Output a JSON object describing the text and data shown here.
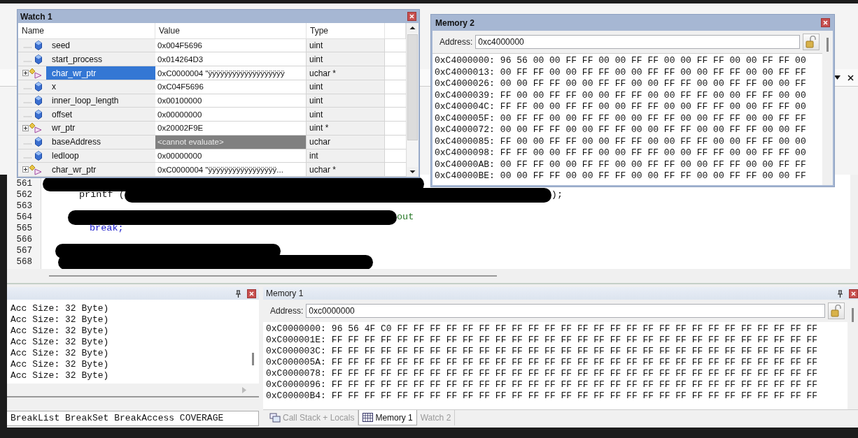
{
  "watch_window": {
    "title": "Watch 1",
    "columns": [
      "Name",
      "Value",
      "Type"
    ],
    "rows": [
      {
        "kind": "variable",
        "name": "seed",
        "value": "0x004F5696",
        "type": "uint",
        "selected": false,
        "unavailable": false
      },
      {
        "kind": "variable",
        "name": "start_process",
        "value": "0x014264D3",
        "type": "uint",
        "selected": false,
        "unavailable": false
      },
      {
        "kind": "pointer",
        "name": "char_wr_ptr",
        "value": "0xC0000004 \"ÿÿÿÿÿÿÿÿÿÿÿÿÿÿÿÿÿÿÿ",
        "type": "uchar *",
        "selected": true,
        "unavailable": false
      },
      {
        "kind": "variable",
        "name": "x",
        "value": "0xC04F5696",
        "type": "uint",
        "selected": false,
        "unavailable": false
      },
      {
        "kind": "variable",
        "name": "inner_loop_length",
        "value": "0x00100000",
        "type": "uint",
        "selected": false,
        "unavailable": false
      },
      {
        "kind": "variable",
        "name": "offset",
        "value": "0x00000000",
        "type": "uint",
        "selected": false,
        "unavailable": false
      },
      {
        "kind": "pointer",
        "name": "wr_ptr",
        "value": "0x20002F9E",
        "type": "uint *",
        "selected": false,
        "unavailable": false
      },
      {
        "kind": "variable",
        "name": "baseAddress",
        "value": "<cannot evaluate>",
        "type": "uchar",
        "selected": false,
        "unavailable": true
      },
      {
        "kind": "variable",
        "name": "ledloop",
        "value": "0x00000000",
        "type": "int",
        "selected": false,
        "unavailable": false
      },
      {
        "kind": "pointer",
        "name": "char_wr_ptr",
        "value": "0xC0000004 \"ÿÿÿÿÿÿÿÿÿÿÿÿÿÿÿÿÿ...",
        "type": "uchar *",
        "selected": false,
        "unavailable": false
      }
    ]
  },
  "memory_2": {
    "title": "Memory 2",
    "address_label": "Address:",
    "address": "0xc4000000",
    "rows": [
      {
        "address": "0xC4000000:",
        "bytes": "96 56 00 00 FF FF 00 00 FF FF 00 00 FF FF 00 00 FF FF 00"
      },
      {
        "address": "0xC4000013:",
        "bytes": "00 FF FF 00 00 FF FF 00 00 FF FF 00 00 FF FF 00 00 FF FF"
      },
      {
        "address": "0xC4000026:",
        "bytes": "00 00 FF FF 00 00 FF FF 00 00 FF FF 00 00 FF FF 00 00 FF"
      },
      {
        "address": "0xC4000039:",
        "bytes": "FF 00 00 FF FF 00 00 FF FF 00 00 FF FF 00 00 FF FF 00 00"
      },
      {
        "address": "0xC400004C:",
        "bytes": "FF FF 00 00 FF FF 00 00 FF FF 00 00 FF FF 00 00 FF FF 00"
      },
      {
        "address": "0xC400005F:",
        "bytes": "00 FF FF 00 00 FF FF 00 00 FF FF 00 00 FF FF 00 00 FF FF"
      },
      {
        "address": "0xC4000072:",
        "bytes": "00 00 FF FF 00 00 FF FF 00 00 FF FF 00 00 FF FF 00 00 FF"
      },
      {
        "address": "0xC4000085:",
        "bytes": "FF 00 00 FF FF 00 00 FF FF 00 00 FF FF 00 00 FF FF 00 00"
      },
      {
        "address": "0xC4000098:",
        "bytes": "FF FF 00 00 FF FF 00 00 FF FF 00 00 FF FF 00 00 FF FF 00"
      },
      {
        "address": "0xC40000AB:",
        "bytes": "00 FF FF 00 00 FF FF 00 00 FF FF 00 00 FF FF 00 00 FF FF"
      },
      {
        "address": "0xC40000BE:",
        "bytes": "00 00 FF FF 00 00 FF FF 00 00 FF FF 00 00 FF FF 00 00 FF"
      }
    ]
  },
  "editor": {
    "lines": [
      {
        "number": "561",
        "segments": [
          {
            "kind": "redacted"
          }
        ]
      },
      {
        "number": "562",
        "segments": [
          {
            "kind": "plain",
            "text": "printf ("
          },
          {
            "kind": "redacted"
          },
          {
            "kind": "plain",
            "text": ");"
          }
        ]
      },
      {
        "number": "563"
      },
      {
        "number": "564",
        "segments": [
          {
            "kind": "redacted"
          },
          {
            "kind": "comment",
            "text": "out"
          }
        ]
      },
      {
        "number": "565",
        "segments": [
          {
            "kind": "keyword",
            "text": "break;"
          }
        ]
      },
      {
        "number": "566"
      },
      {
        "number": "567",
        "segments": [
          {
            "kind": "redacted"
          }
        ]
      },
      {
        "number": "568",
        "segments": [
          {
            "kind": "redacted"
          }
        ]
      }
    ]
  },
  "output_panel": {
    "lines": [
      "Acc Size: 32 Byte)",
      "Acc Size: 32 Byte)",
      "Acc Size: 32 Byte)",
      "Acc Size: 32 Byte)",
      "Acc Size: 32 Byte)",
      "Acc Size: 32 Byte)",
      "Acc Size: 32 Byte)"
    ],
    "command_line": "BreakList BreakSet BreakAccess COVERAGE"
  },
  "memory_1": {
    "title": "Memory 1",
    "address_label": "Address:",
    "address": "0xc0000000",
    "rows": [
      {
        "address": "0xC0000000:",
        "bytes": "96 56 4F C0 FF FF FF FF FF FF FF FF FF FF FF FF FF FF FF FF FF FF FF FF FF FF FF FF FF FF"
      },
      {
        "address": "0xC000001E:",
        "bytes": "FF FF FF FF FF FF FF FF FF FF FF FF FF FF FF FF FF FF FF FF FF FF FF FF FF FF FF FF FF FF"
      },
      {
        "address": "0xC000003C:",
        "bytes": "FF FF FF FF FF FF FF FF FF FF FF FF FF FF FF FF FF FF FF FF FF FF FF FF FF FF FF FF FF FF"
      },
      {
        "address": "0xC000005A:",
        "bytes": "FF FF FF FF FF FF FF FF FF FF FF FF FF FF FF FF FF FF FF FF FF FF FF FF FF FF FF FF FF FF"
      },
      {
        "address": "0xC0000078:",
        "bytes": "FF FF FF FF FF FF FF FF FF FF FF FF FF FF FF FF FF FF FF FF FF FF FF FF FF FF FF FF FF FF"
      },
      {
        "address": "0xC0000096:",
        "bytes": "FF FF FF FF FF FF FF FF FF FF FF FF FF FF FF FF FF FF FF FF FF FF FF FF FF FF FF FF FF FF"
      },
      {
        "address": "0xC00000B4:",
        "bytes": "FF FF FF FF FF FF FF FF FF FF FF FF FF FF FF FF FF FF FF FF FF FF FF FF FF FF FF FF FF FF"
      }
    ]
  },
  "bottom_tabs": [
    {
      "kind": "callstack",
      "label": "Call Stack + Locals",
      "selected": false
    },
    {
      "kind": "memory",
      "label": "Memory 1",
      "selected": true
    },
    {
      "kind": "watch",
      "label": "Watch 2",
      "selected": false
    }
  ]
}
